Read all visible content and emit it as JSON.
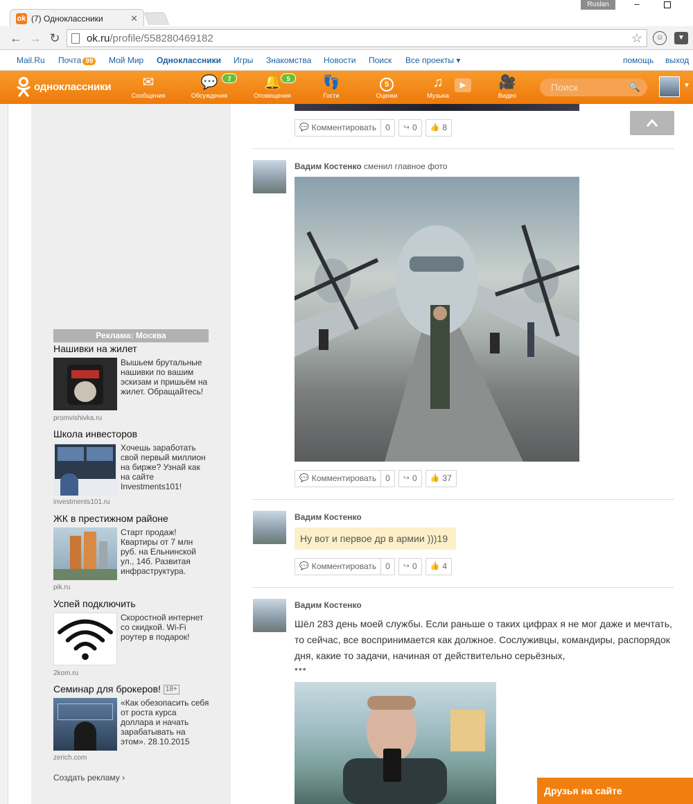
{
  "browser": {
    "tab_title": "(7) Одноклассники",
    "tab_favicon": "ok-favicon",
    "url_host": "ok.ru",
    "url_path": "/profile/558280469182",
    "user_badge": "Ruslan"
  },
  "portal_bar": {
    "items": [
      {
        "label": "Mail.Ru"
      },
      {
        "label": "Почта",
        "badge": "99"
      },
      {
        "label": "Мой Мир"
      },
      {
        "label": "Одноклассники",
        "active": true
      },
      {
        "label": "Игры"
      },
      {
        "label": "Знакомства"
      },
      {
        "label": "Новости"
      },
      {
        "label": "Поиск"
      },
      {
        "label": "Все проекты ▾"
      }
    ],
    "help": "помощь",
    "logout": "выход"
  },
  "ok_header": {
    "logo_text": "одноклассники",
    "nav": [
      {
        "label": "Сообщения",
        "icon": "envelope-icon"
      },
      {
        "label": "Обсуждения",
        "icon": "chat-icon",
        "badge": "7"
      },
      {
        "label": "Оповещения",
        "icon": "bell-icon",
        "badge": "5"
      },
      {
        "label": "Гости",
        "icon": "footprints-icon"
      },
      {
        "label": "Оценки",
        "icon": "rating-icon",
        "badge_inline": "5"
      },
      {
        "label": "Музыка",
        "icon": "music-icon"
      },
      {
        "label": "Видео",
        "icon": "video-camera-icon"
      }
    ],
    "search_placeholder": "Поиск",
    "brand_color": "#f07f10"
  },
  "ads": {
    "header": "Реклама: Москва",
    "items": [
      {
        "title": "Нашивки на жилет",
        "text": "Вышьем брутальные нашивки по вашим эскизам и пришьём на жилет. Обращайтесь!",
        "domain": "promvishivka.ru"
      },
      {
        "title": "Школа инвесторов",
        "text": "Хочешь заработать свой первый миллион на бирже? Узнай как на сайте Investments101!",
        "domain": "investments101.ru"
      },
      {
        "title": "ЖК в престижном районе",
        "text": "Старт продаж! Квартиры от 7 млн руб. на Ельнинской ул., 14б. Развитая инфраструктура.",
        "domain": "pik.ru"
      },
      {
        "title": "Успей подключить",
        "text": "Скоростной интернет со скидкой. Wi-Fi роутер в подарок!",
        "domain": "2kom.ru"
      },
      {
        "title": "Семинар для брокеров!",
        "age": "18+",
        "text": "«Как обезопасить себя от роста курса доллара и начать зарабатывать на этом». 28.10.2015",
        "domain": "zerich.com"
      }
    ],
    "create": "Создать рекламу ›"
  },
  "feed": {
    "comment_label": "Комментировать",
    "posts": [
      {
        "comments": "0",
        "shares": "0",
        "likes": "8"
      },
      {
        "author": "Вадим Костенко",
        "action": "сменил главное фото",
        "comments": "0",
        "shares": "0",
        "likes": "37"
      },
      {
        "author": "Вадим Костенко",
        "status": "Ну вот и первое др в армии )))19",
        "comments": "0",
        "shares": "0",
        "likes": "4"
      },
      {
        "author": "Вадим Костенко",
        "text": "Шёл 283 день моей службы. Если раньше о таких цифрах я не мог даже и мечтать, то сейчас, все воспринимается как должное. Сослуживцы, командиры, распорядок дня, какие то задачи, начиная от действительно серьёзных,",
        "more": "•••"
      }
    ]
  },
  "friends_panel": "Друзья на сайте"
}
